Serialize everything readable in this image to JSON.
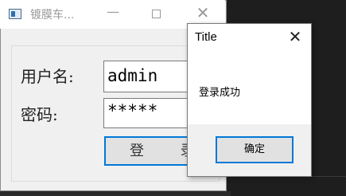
{
  "main_window": {
    "title": "镀膜车...",
    "controls": {
      "minimize": "—",
      "close": "✕"
    },
    "form": {
      "username_label": "用户名:",
      "username_value": "admin",
      "password_label": "密码:",
      "password_value": "*****",
      "login_button": "登 录"
    }
  },
  "message_box": {
    "title": "Title",
    "close": "✕",
    "message": "登录成功",
    "ok_button": "确定"
  },
  "colors": {
    "accent": "#0078d7",
    "window_bg": "#f0f0f0",
    "editor_bg": "#1e1e1e"
  }
}
